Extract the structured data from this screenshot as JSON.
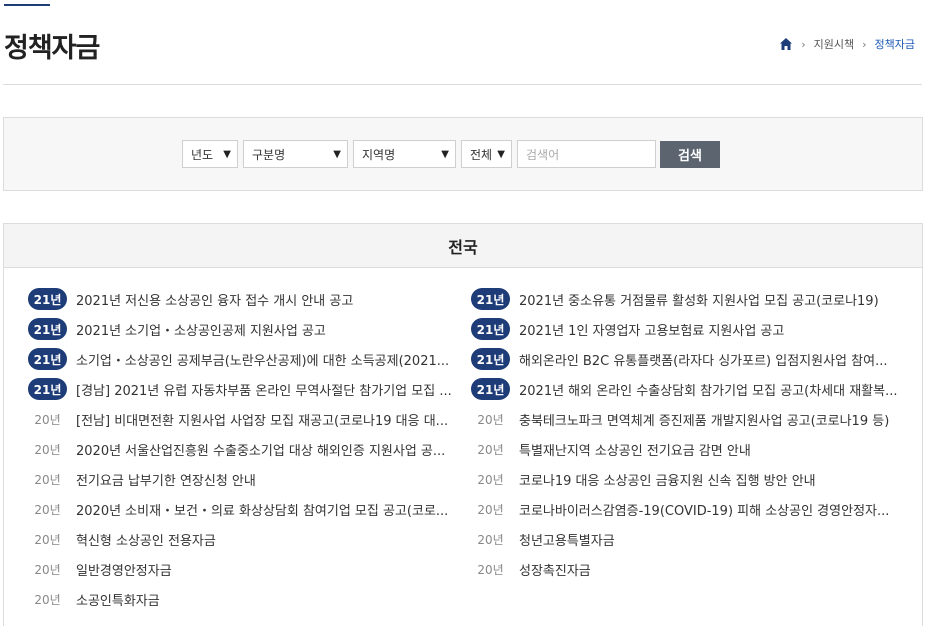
{
  "page": {
    "title": "정책자금"
  },
  "breadcrumb": {
    "items": [
      "지원시책",
      "정책자금"
    ]
  },
  "search": {
    "year_select": "년도",
    "category_select": "구분명",
    "region_select": "지역명",
    "scope_select": "전체",
    "input_placeholder": "검색어",
    "button_label": "검색"
  },
  "list": {
    "header": "전국",
    "left": [
      {
        "year": "21년",
        "active": true,
        "text": "2021년 저신용 소상공인 융자 접수 개시 안내 공고"
      },
      {
        "year": "21년",
        "active": true,
        "text": "2021년 소기업・소상공인공제 지원사업 공고"
      },
      {
        "year": "21년",
        "active": true,
        "text": "소기업・소상공인 공제부금(노란우산공제)에 대한 소득공제(2021..."
      },
      {
        "year": "21년",
        "active": true,
        "text": "[경남] 2021년 유럽 자동차부품 온라인 무역사절단 참가기업 모집 ..."
      },
      {
        "year": "20년",
        "active": false,
        "text": "[전남] 비대면전환 지원사업 사업장 모집 재공고(코로나19 대응 대..."
      },
      {
        "year": "20년",
        "active": false,
        "text": "2020년 서울산업진흥원 수출중소기업 대상 해외인증 지원사업 공..."
      },
      {
        "year": "20년",
        "active": false,
        "text": "전기요금 납부기한 연장신청 안내"
      },
      {
        "year": "20년",
        "active": false,
        "text": "2020년 소비재・보건・의료 화상상담회 참여기업 모집 공고(코로..."
      },
      {
        "year": "20년",
        "active": false,
        "text": "혁신형 소상공인 전용자금"
      },
      {
        "year": "20년",
        "active": false,
        "text": "일반경영안정자금"
      },
      {
        "year": "20년",
        "active": false,
        "text": "소공인특화자금"
      }
    ],
    "right": [
      {
        "year": "21년",
        "active": true,
        "text": "2021년 중소유통 거점물류 활성화 지원사업 모집 공고(코로나19)"
      },
      {
        "year": "21년",
        "active": true,
        "text": "2021년 1인 자영업자 고용보험료 지원사업 공고"
      },
      {
        "year": "21년",
        "active": true,
        "text": "해외온라인 B2C 유통플랫폼(라자다 싱가포르) 입점지원사업 참여..."
      },
      {
        "year": "21년",
        "active": true,
        "text": "2021년 해외 온라인 수출상담회 참가기업 모집 공고(차세대 재활복..."
      },
      {
        "year": "20년",
        "active": false,
        "text": "충북테크노파크 면역체계 증진제품 개발지원사업 공고(코로나19 등)"
      },
      {
        "year": "20년",
        "active": false,
        "text": "특별재난지역 소상공인 전기요금 감면 안내"
      },
      {
        "year": "20년",
        "active": false,
        "text": "코로나19 대응 소상공인 금융지원 신속 집행 방안 안내"
      },
      {
        "year": "20년",
        "active": false,
        "text": "코로나바이러스감염증-19(COVID-19) 피해 소상공인 경영안정자..."
      },
      {
        "year": "20년",
        "active": false,
        "text": "청년고용특별자금"
      },
      {
        "year": "20년",
        "active": false,
        "text": "성장촉진자금"
      }
    ]
  },
  "colors": {
    "accent": "#1e3c78",
    "breadcrumb_current": "#1e5ab4",
    "search_button": "#5c6470"
  },
  "icons": {
    "home": "home-icon",
    "breadcrumb_separator": "chevron-right-icon",
    "select_arrow": "chevron-down-icon"
  }
}
